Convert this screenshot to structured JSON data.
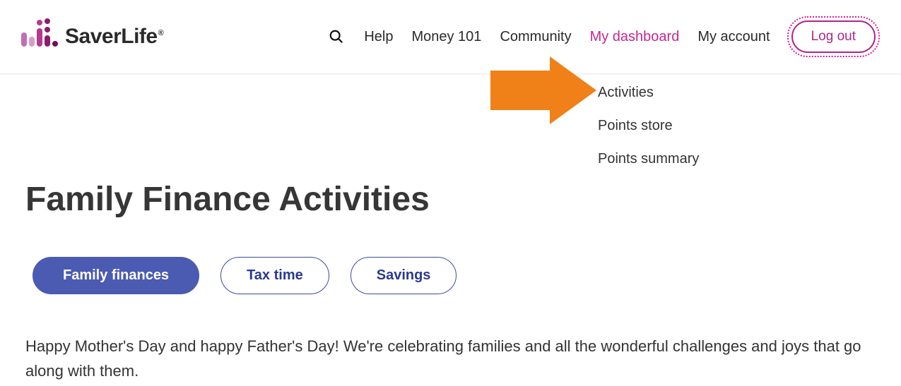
{
  "brand": {
    "name": "SaverLife",
    "reg": "®"
  },
  "nav": {
    "help": "Help",
    "money101": "Money 101",
    "community": "Community",
    "dashboard": "My dashboard",
    "account": "My account"
  },
  "logout": "Log out",
  "submenu": {
    "activities": "Activities",
    "points_store": "Points store",
    "points_summary": "Points summary"
  },
  "page": {
    "title": "Family Finance Activities",
    "tabs": {
      "family_finances": "Family finances",
      "tax_time": "Tax time",
      "savings": "Savings"
    },
    "intro": "Happy Mother's Day and happy Father's Day! We're celebrating families and all the wonderful challenges and joys that go along with them."
  }
}
